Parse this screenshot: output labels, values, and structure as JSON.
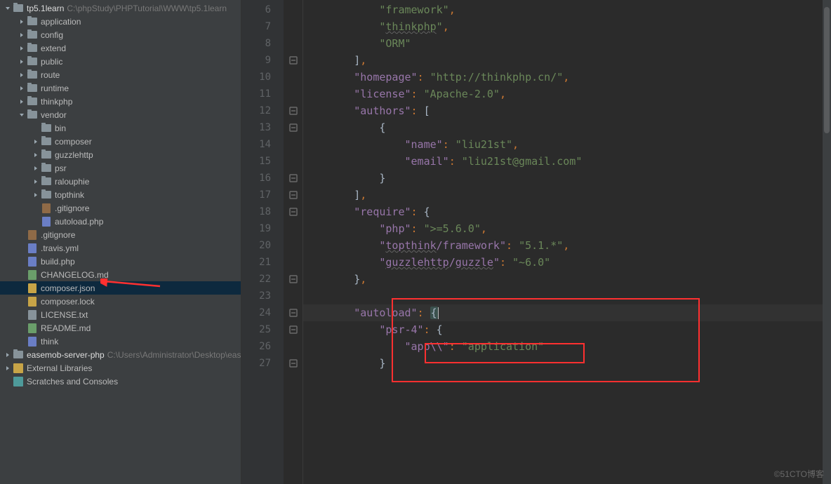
{
  "project": {
    "name": "tp5.1learn",
    "path": "C:\\phpStudy\\PHPTutorial\\WWW\\tp5.1learn",
    "tree": [
      {
        "label": "application",
        "type": "folder",
        "indent": 1,
        "arrow": "right"
      },
      {
        "label": "config",
        "type": "folder",
        "indent": 1,
        "arrow": "right"
      },
      {
        "label": "extend",
        "type": "folder",
        "indent": 1,
        "arrow": "right"
      },
      {
        "label": "public",
        "type": "folder",
        "indent": 1,
        "arrow": "right"
      },
      {
        "label": "route",
        "type": "folder",
        "indent": 1,
        "arrow": "right"
      },
      {
        "label": "runtime",
        "type": "folder",
        "indent": 1,
        "arrow": "right"
      },
      {
        "label": "thinkphp",
        "type": "folder",
        "indent": 1,
        "arrow": "right"
      },
      {
        "label": "vendor",
        "type": "folder",
        "indent": 1,
        "arrow": "down"
      },
      {
        "label": "bin",
        "type": "folder",
        "indent": 2,
        "arrow": ""
      },
      {
        "label": "composer",
        "type": "folder",
        "indent": 2,
        "arrow": "right"
      },
      {
        "label": "guzzlehttp",
        "type": "folder",
        "indent": 2,
        "arrow": "right"
      },
      {
        "label": "psr",
        "type": "folder",
        "indent": 2,
        "arrow": "right"
      },
      {
        "label": "ralouphie",
        "type": "folder",
        "indent": 2,
        "arrow": "right"
      },
      {
        "label": "topthink",
        "type": "folder",
        "indent": 2,
        "arrow": "right"
      },
      {
        "label": ".gitignore",
        "type": "file",
        "icon": "gitignore",
        "indent": 2
      },
      {
        "label": "autoload.php",
        "type": "file",
        "icon": "php",
        "indent": 2
      },
      {
        "label": ".gitignore",
        "type": "file",
        "icon": "gitignore",
        "indent": 1
      },
      {
        "label": ".travis.yml",
        "type": "file",
        "icon": "yml",
        "indent": 1
      },
      {
        "label": "build.php",
        "type": "file",
        "icon": "php",
        "indent": 1
      },
      {
        "label": "CHANGELOG.md",
        "type": "file",
        "icon": "md",
        "indent": 1
      },
      {
        "label": "composer.json",
        "type": "file",
        "icon": "json",
        "indent": 1,
        "selected": true
      },
      {
        "label": "composer.lock",
        "type": "file",
        "icon": "json",
        "indent": 1
      },
      {
        "label": "LICENSE.txt",
        "type": "file",
        "icon": "txt",
        "indent": 1
      },
      {
        "label": "README.md",
        "type": "file",
        "icon": "md",
        "indent": 1
      },
      {
        "label": "think",
        "type": "file",
        "icon": "php",
        "indent": 1
      }
    ],
    "extra": [
      {
        "label": "easemob-server-php",
        "dim": "C:\\Users\\Administrator\\Desktop\\easem",
        "type": "folder",
        "arrow": "right"
      },
      {
        "label": "External Libraries",
        "type": "lib",
        "arrow": "right"
      },
      {
        "label": "Scratches and Consoles",
        "type": "scratch",
        "arrow": ""
      }
    ]
  },
  "editor": {
    "lines": [
      {
        "n": 6,
        "html": "            <span class='s'>\"framework\"</span><span class='p'>,</span>"
      },
      {
        "n": 7,
        "html": "            <span class='s'>\"<span class='u'>thinkphp</span>\"</span><span class='p'>,</span>"
      },
      {
        "n": 8,
        "html": "            <span class='s'>\"ORM\"</span>"
      },
      {
        "n": 9,
        "html": "        <span class='d'>]</span><span class='p'>,</span>",
        "fold": "close"
      },
      {
        "n": 10,
        "html": "        <span class='k'>\"homepage\"</span><span class='p'>:</span> <span class='s'>\"http://thinkphp.cn/\"</span><span class='p'>,</span>"
      },
      {
        "n": 11,
        "html": "        <span class='k'>\"license\"</span><span class='p'>:</span> <span class='s'>\"Apache-2.0\"</span><span class='p'>,</span>"
      },
      {
        "n": 12,
        "html": "        <span class='k'>\"authors\"</span><span class='p'>:</span> <span class='d'>[</span>",
        "fold": "open"
      },
      {
        "n": 13,
        "html": "            <span class='d'>{</span>",
        "fold": "open"
      },
      {
        "n": 14,
        "html": "                <span class='k'>\"name\"</span><span class='p'>:</span> <span class='s'>\"liu21st\"</span><span class='p'>,</span>"
      },
      {
        "n": 15,
        "html": "                <span class='k'>\"email\"</span><span class='p'>:</span> <span class='s'>\"liu21st@gmail.com\"</span>"
      },
      {
        "n": 16,
        "html": "            <span class='d'>}</span>",
        "fold": "close"
      },
      {
        "n": 17,
        "html": "        <span class='d'>]</span><span class='p'>,</span>",
        "fold": "close"
      },
      {
        "n": 18,
        "html": "        <span class='k'>\"require\"</span><span class='p'>:</span> <span class='d'>{</span>",
        "fold": "open"
      },
      {
        "n": 19,
        "html": "            <span class='k'>\"php\"</span><span class='p'>:</span> <span class='s'>\">=5.6.0\"</span><span class='p'>,</span>"
      },
      {
        "n": 20,
        "html": "            <span class='k'>\"<span class='u'>topthink</span>/framework\"</span><span class='p'>:</span> <span class='s'>\"5.1.*\"</span><span class='p'>,</span>"
      },
      {
        "n": 21,
        "html": "            <span class='k'>\"<span class='u'>guzzlehttp</span>/<span class='u'>guzzle</span>\"</span><span class='p'>:</span> <span class='s'>\"~6.0\"</span>"
      },
      {
        "n": 22,
        "html": "        <span class='d'>}</span><span class='p'>,</span>",
        "fold": "close"
      },
      {
        "n": 23,
        "html": ""
      },
      {
        "n": 24,
        "html": "        <span class='k'>\"autoload\"</span><span class='p'>:</span> <span class='d rs-brace'>{</span><span class='caret'></span>",
        "current": true,
        "fold": "open"
      },
      {
        "n": 25,
        "html": "            <span class='k'>\"psr-4\"</span><span class='p'>:</span> <span class='d'>{</span>",
        "fold": "open"
      },
      {
        "n": 26,
        "html": "                <span class='k'>\"app\\\\\"</span><span class='p'>:</span> <span class='s'>\"application\"</span>"
      },
      {
        "n": 27,
        "html": "            <span class='d'>}</span>",
        "fold": "close"
      }
    ]
  },
  "watermark": "©51CTO博客"
}
